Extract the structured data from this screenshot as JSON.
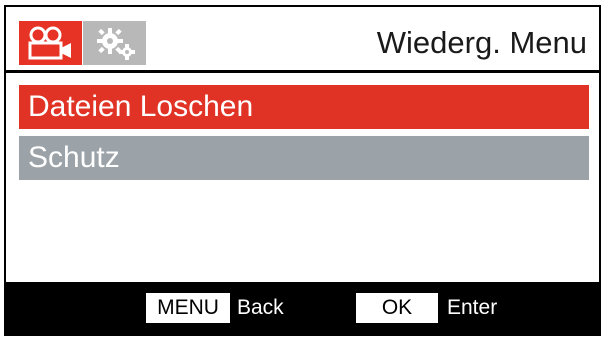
{
  "header": {
    "title": "Wiederg. Menu",
    "tabs": [
      {
        "icon": "video-camera-icon",
        "active": true,
        "color": "#e63326"
      },
      {
        "icon": "gears-icon",
        "active": false,
        "color": "#b8b8b8"
      }
    ]
  },
  "menu": {
    "items": [
      {
        "label": "Dateien Loschen",
        "selected": true
      },
      {
        "label": "Schutz",
        "selected": false
      }
    ],
    "colors": {
      "selected": "#e13325",
      "normal": "#9ba3a8"
    }
  },
  "footer": {
    "menu_key": "MENU",
    "menu_action": "Back",
    "ok_key": "OK",
    "ok_action": "Enter"
  }
}
